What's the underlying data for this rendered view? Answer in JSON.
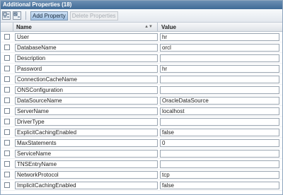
{
  "title": "Additional Properties (18)",
  "toolbar": {
    "add_label": "Add Property",
    "delete_label": "Delete Properties"
  },
  "columns": {
    "name": "Name",
    "value": "Value"
  },
  "rows": [
    {
      "name": "User",
      "value": "hr"
    },
    {
      "name": "DatabaseName",
      "value": "orcl"
    },
    {
      "name": "Description",
      "value": ""
    },
    {
      "name": "Password",
      "value": "hr"
    },
    {
      "name": "ConnectionCacheName",
      "value": ""
    },
    {
      "name": "ONSConfiguration",
      "value": ""
    },
    {
      "name": "DataSourceName",
      "value": "OracleDataSource"
    },
    {
      "name": "ServerName",
      "value": "localhost"
    },
    {
      "name": "DriverType",
      "value": ""
    },
    {
      "name": "ExplicitCachingEnabled",
      "value": "false"
    },
    {
      "name": "MaxStatements",
      "value": "0"
    },
    {
      "name": "ServiceName",
      "value": ""
    },
    {
      "name": "TNSEntryName",
      "value": ""
    },
    {
      "name": "NetworkProtocol",
      "value": "tcp"
    },
    {
      "name": "ImplicitCachingEnabled",
      "value": "false"
    }
  ]
}
